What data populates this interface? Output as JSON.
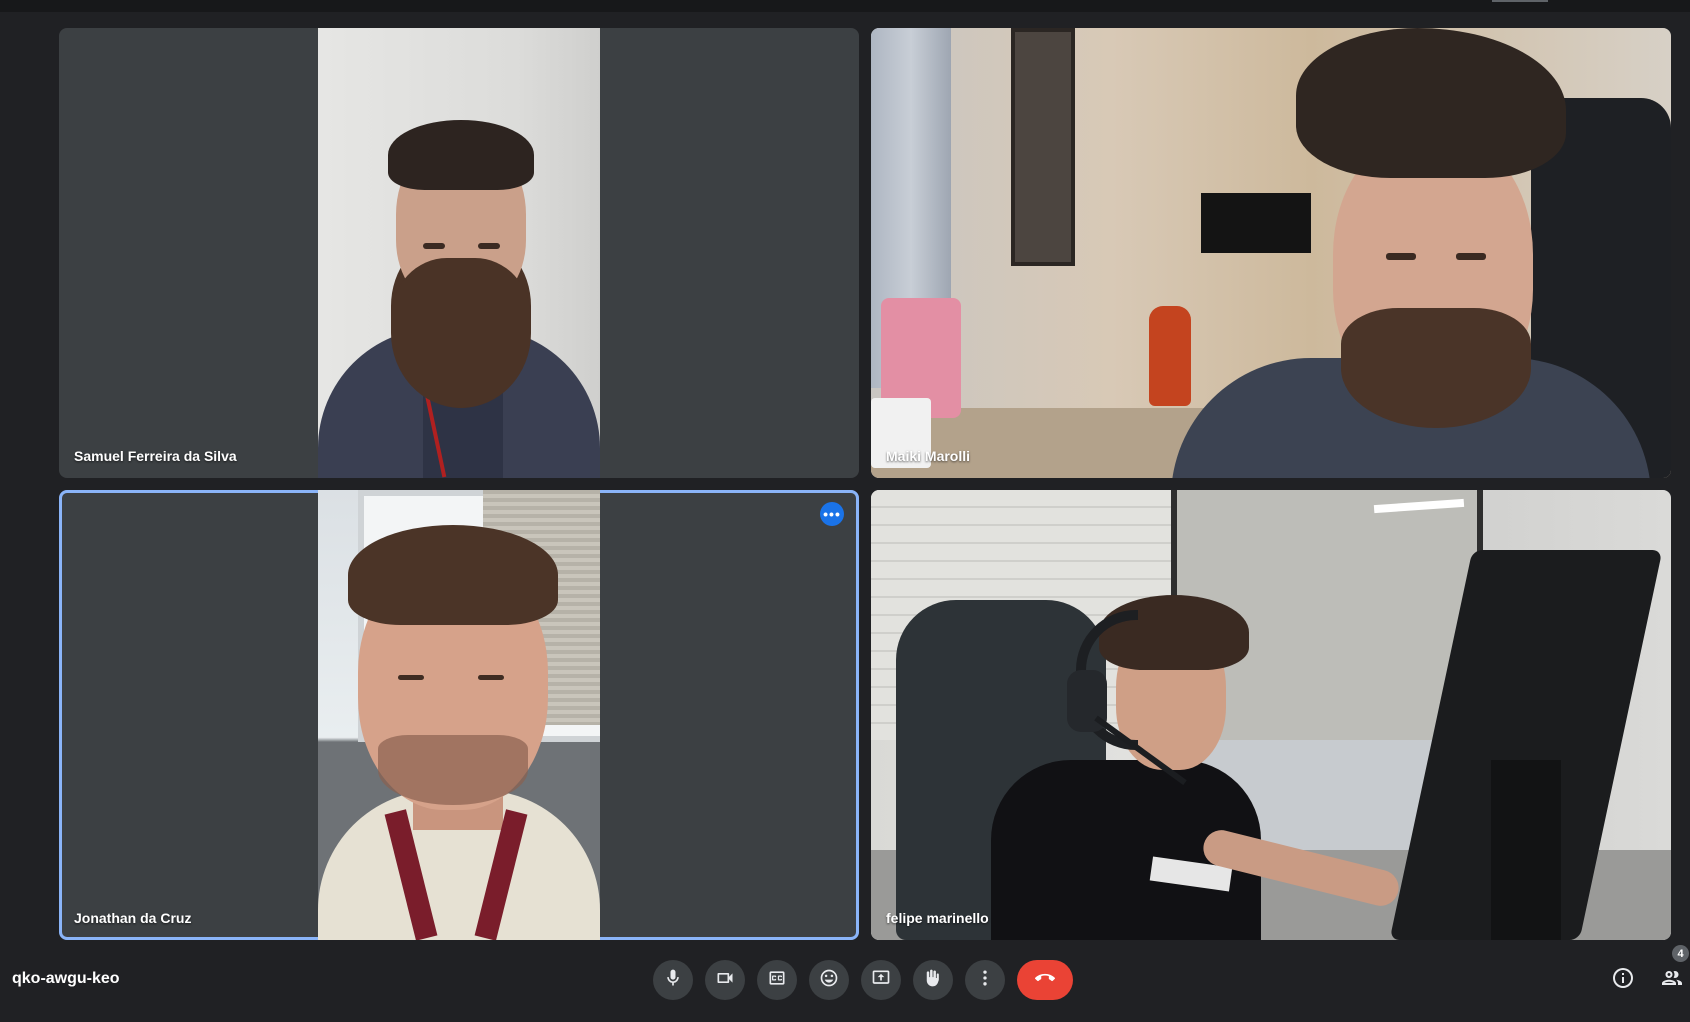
{
  "participants": [
    {
      "name": "Samuel Ferreira da Silva"
    },
    {
      "name": "Maiki Marolli"
    },
    {
      "name": "Jonathan da Cruz"
    },
    {
      "name": "felipe marinello"
    }
  ],
  "active_tile": {
    "more_label": "•••"
  },
  "bottombar": {
    "meeting_code": "qko-awgu-keo",
    "participant_count": "4"
  },
  "controls": [
    {
      "icon": "microphone-icon"
    },
    {
      "icon": "camera-icon"
    },
    {
      "icon": "captions-icon"
    },
    {
      "icon": "emoji-icon"
    },
    {
      "icon": "present-screen-icon"
    },
    {
      "icon": "raise-hand-icon"
    },
    {
      "icon": "more-options-icon"
    },
    {
      "icon": "end-call-icon"
    }
  ],
  "colors": {
    "background": "#202124",
    "tile": "#3c4043",
    "active_outline": "#8ab4f8",
    "end_call": "#ea4335",
    "more_button": "#1a73e8"
  }
}
